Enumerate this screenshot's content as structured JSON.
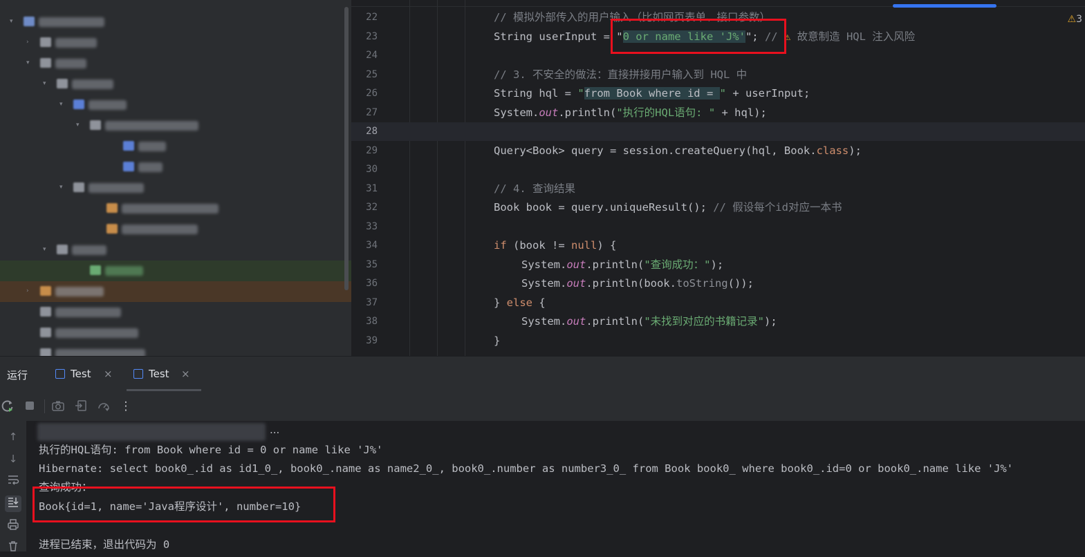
{
  "project_tree": {
    "rows": [
      {
        "indent": 0,
        "arrow": "▾",
        "icon": "#6f8bc7",
        "label_color": "#8f939b",
        "label_w": 95
      },
      {
        "indent": 1,
        "arrow": "›",
        "icon": "#8f939b",
        "label_color": "#8f939b",
        "label_w": 60
      },
      {
        "indent": 1,
        "arrow": "▾",
        "icon": "#8f939b",
        "label_color": "#8f939b",
        "label_w": 45
      },
      {
        "indent": 2,
        "arrow": "▾",
        "icon": "#8f939b",
        "label_color": "#8f939b",
        "label_w": 60
      },
      {
        "indent": 3,
        "arrow": "▾",
        "icon": "#5b7fd6",
        "label_color": "#8f939b",
        "label_w": 55
      },
      {
        "indent": 4,
        "arrow": "▾",
        "icon": "#8f939b",
        "label_color": "#8f939b",
        "label_w": 135
      },
      {
        "indent": 6,
        "arrow": "",
        "icon": "#5b7fd6",
        "label_color": "#8f939b",
        "label_w": 40
      },
      {
        "indent": 6,
        "arrow": "",
        "icon": "#5b7fd6",
        "label_color": "#8f939b",
        "label_w": 35
      },
      {
        "indent": 3,
        "arrow": "▾",
        "icon": "#8f939b",
        "label_color": "#8f939b",
        "label_w": 80
      },
      {
        "indent": 5,
        "arrow": "",
        "icon": "#c78d4a",
        "label_color": "#8f939b",
        "label_w": 140
      },
      {
        "indent": 5,
        "arrow": "",
        "icon": "#c78d4a",
        "label_color": "#8f939b",
        "label_w": 110
      },
      {
        "indent": 2,
        "arrow": "▾",
        "icon": "#8f939b",
        "label_color": "#8f939b",
        "label_w": 50
      },
      {
        "indent": 4,
        "arrow": "",
        "icon": "#6aab73",
        "label_color": "#6aab73",
        "label_w": 55,
        "highlight": "green"
      },
      {
        "indent": 1,
        "arrow": "›",
        "icon": "#c78d4a",
        "label_color": "#a3a6ad",
        "label_w": 70,
        "highlight": "orange"
      },
      {
        "indent": 1,
        "arrow": "",
        "icon": "#8f939b",
        "label_color": "#8f939b",
        "label_w": 95
      },
      {
        "indent": 1,
        "arrow": "",
        "icon": "#8f939b",
        "label_color": "#8f939b",
        "label_w": 120
      },
      {
        "indent": 1,
        "arrow": "",
        "icon": "#8f939b",
        "label_color": "#8f939b",
        "label_w": 130
      }
    ]
  },
  "editor": {
    "warning_count": "3",
    "current_line": "28",
    "lines": [
      {
        "n": "22",
        "indent": 2,
        "tokens": [
          [
            "cm",
            "// 模拟外部传入的用户输入（比如网页表单、接口参数）"
          ]
        ]
      },
      {
        "n": "23",
        "indent": 2,
        "tokens": [
          [
            "txt",
            "String userInput = \""
          ],
          [
            "str hlbg",
            "0 or name like 'J%'"
          ],
          [
            "txt",
            "\"; "
          ],
          [
            "cm",
            "// "
          ],
          [
            "warn-tri",
            "⚠"
          ],
          [
            "cm",
            " 故意制造 HQL 注入风险"
          ]
        ]
      },
      {
        "n": "24",
        "indent": 2,
        "tokens": []
      },
      {
        "n": "25",
        "indent": 2,
        "tokens": [
          [
            "cm",
            "// 3. 不安全的做法：直接拼接用户输入到 HQL 中"
          ]
        ]
      },
      {
        "n": "26",
        "indent": 2,
        "tokens": [
          [
            "txt",
            "String hql = "
          ],
          [
            "str",
            "\""
          ],
          [
            "txt hlbg",
            "from Book where id = "
          ],
          [
            "str",
            "\""
          ],
          [
            "txt",
            " + userInput;"
          ]
        ]
      },
      {
        "n": "27",
        "indent": 2,
        "tokens": [
          [
            "txt",
            "System."
          ],
          [
            "fld",
            "out"
          ],
          [
            "txt",
            ".println("
          ],
          [
            "str",
            "\"执行的HQL语句: \""
          ],
          [
            "txt",
            " + hql);"
          ]
        ]
      },
      {
        "n": "28",
        "indent": 2,
        "tokens": []
      },
      {
        "n": "29",
        "indent": 2,
        "tokens": [
          [
            "txt",
            "Query<Book> query = session.createQuery(hql, Book."
          ],
          [
            "kw",
            "class"
          ],
          [
            "txt",
            ");"
          ]
        ]
      },
      {
        "n": "30",
        "indent": 2,
        "tokens": []
      },
      {
        "n": "31",
        "indent": 2,
        "tokens": [
          [
            "cm",
            "// 4. 查询结果"
          ]
        ]
      },
      {
        "n": "32",
        "indent": 2,
        "tokens": [
          [
            "txt",
            "Book book = query.uniqueResult(); "
          ],
          [
            "cm",
            "// 假设每个id对应一本书"
          ]
        ]
      },
      {
        "n": "33",
        "indent": 2,
        "tokens": []
      },
      {
        "n": "34",
        "indent": 2,
        "tokens": [
          [
            "kw",
            "if"
          ],
          [
            "txt",
            " (book != "
          ],
          [
            "kw",
            "null"
          ],
          [
            "txt",
            ") {"
          ]
        ]
      },
      {
        "n": "35",
        "indent": 3,
        "tokens": [
          [
            "txt",
            "System."
          ],
          [
            "fld",
            "out"
          ],
          [
            "txt",
            ".println("
          ],
          [
            "str",
            "\"查询成功：\""
          ],
          [
            "txt",
            ");"
          ]
        ]
      },
      {
        "n": "36",
        "indent": 3,
        "tokens": [
          [
            "txt",
            "System."
          ],
          [
            "fld",
            "out"
          ],
          [
            "txt",
            ".println(book."
          ],
          [
            "gray",
            "toString"
          ],
          [
            "txt",
            "());"
          ]
        ]
      },
      {
        "n": "37",
        "indent": 2,
        "tokens": [
          [
            "txt",
            "} "
          ],
          [
            "kw",
            "else"
          ],
          [
            "txt",
            " {"
          ]
        ]
      },
      {
        "n": "38",
        "indent": 3,
        "tokens": [
          [
            "txt",
            "System."
          ],
          [
            "fld",
            "out"
          ],
          [
            "txt",
            ".println("
          ],
          [
            "str",
            "\"未找到对应的书籍记录\""
          ],
          [
            "txt",
            ");"
          ]
        ]
      },
      {
        "n": "39",
        "indent": 2,
        "tokens": [
          [
            "txt",
            "}"
          ]
        ]
      }
    ]
  },
  "run_panel": {
    "label": "运行",
    "tabs": [
      {
        "label": "Test",
        "close": "×"
      },
      {
        "label": "Test",
        "close": "×"
      }
    ],
    "more_glyph": "⋮",
    "console": {
      "cmd_suffix": "...",
      "lines": [
        "执行的HQL语句: from Book where id = 0 or name like 'J%'",
        "Hibernate: select book0_.id as id1_0_, book0_.name as name2_0_, book0_.number as number3_0_ from Book book0_ where book0_.id=0 or book0_.name like 'J%'",
        "查询成功：",
        "Book{id=1, name='Java程序设计', number=10}",
        "",
        "进程已结束，退出代码为 0"
      ]
    }
  }
}
